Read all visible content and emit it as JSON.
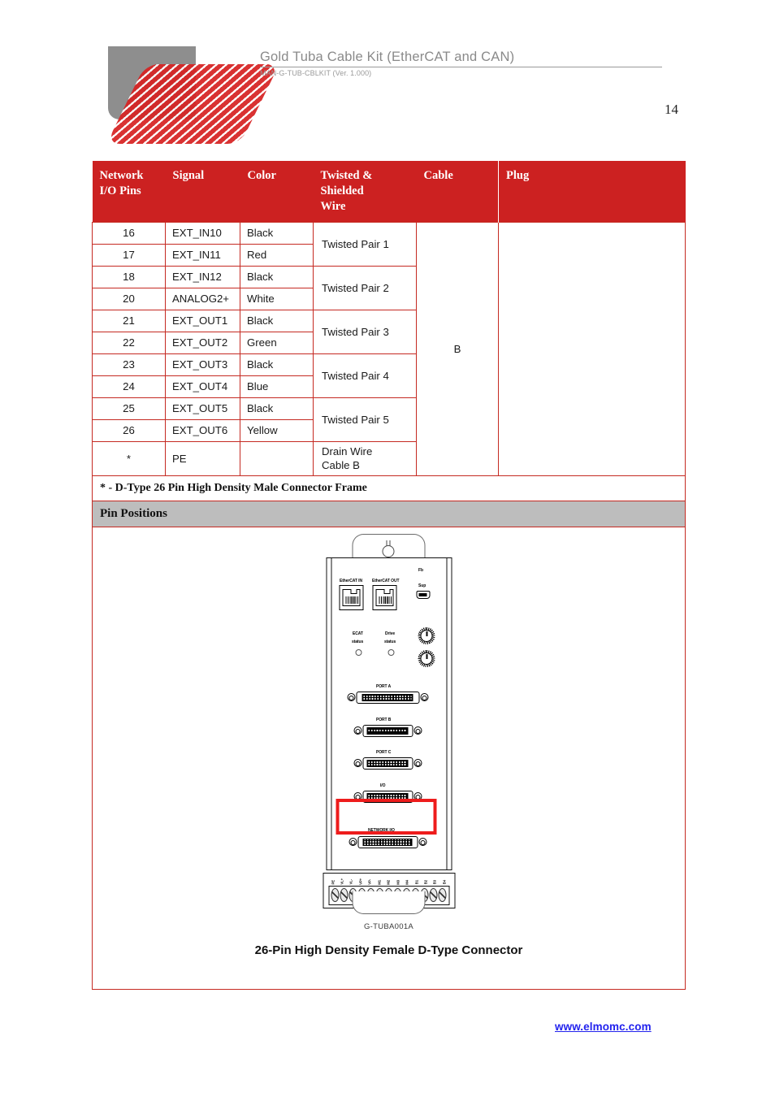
{
  "header": {
    "title": "Gold Tuba Cable Kit (EtherCAT and CAN)",
    "subtitle": "MAN-G-TUB-CBLKIT (Ver. 1.000)",
    "tick": "'",
    "page_number": "14",
    "logo_name": "elmo-logo"
  },
  "colors": {
    "header_red": "#cc2121",
    "border_red": "#c52a22",
    "section_gray": "#bdbdbd",
    "highlight_red": "#ee1c1c",
    "link_blue": "#2222ee",
    "title_gray": "#8a8a8a"
  },
  "table": {
    "columns": [
      "Network I/O Pins",
      "Signal",
      "Color",
      "Twisted & Shielded Wire",
      "Cable",
      "Plug"
    ],
    "column_lines": {
      "c1a": "Network",
      "c1b": "I/O Pins",
      "c4a": "Twisted &",
      "c4b": "Shielded",
      "c4c": "Wire"
    },
    "rows": [
      {
        "pin": "16",
        "signal": "EXT_IN10",
        "color": "Black"
      },
      {
        "pin": "17",
        "signal": "EXT_IN11",
        "color": "Red"
      },
      {
        "pin": "18",
        "signal": "EXT_IN12",
        "color": "Black"
      },
      {
        "pin": "20",
        "signal": "ANALOG2+",
        "color": "White"
      },
      {
        "pin": "21",
        "signal": "EXT_OUT1",
        "color": "Black"
      },
      {
        "pin": "22",
        "signal": "EXT_OUT2",
        "color": "Green"
      },
      {
        "pin": "23",
        "signal": "EXT_OUT3",
        "color": "Black"
      },
      {
        "pin": "24",
        "signal": "EXT_OUT4",
        "color": "Blue"
      },
      {
        "pin": "25",
        "signal": "EXT_OUT5",
        "color": "Black"
      },
      {
        "pin": "26",
        "signal": "EXT_OUT6",
        "color": "Yellow"
      },
      {
        "pin": "*",
        "signal": "PE",
        "color": ""
      }
    ],
    "pairs": [
      "Twisted Pair 1",
      "Twisted Pair 2",
      "Twisted Pair 3",
      "Twisted Pair 4",
      "Twisted Pair 5"
    ],
    "drain": {
      "line1": "Drain Wire",
      "line2": "Cable B"
    },
    "cable": "B",
    "plug": ""
  },
  "note": "* - D-Type 26 Pin High Density Male Connector Frame",
  "section": {
    "title": "Pin Positions"
  },
  "figure": {
    "caption": "26-Pin High Density Female D-Type Connector",
    "drawing_id": "G-TUBA001A",
    "labels": {
      "ethercat_in": "EtherCAT IN",
      "ethercat_out": "EtherCAT OUT",
      "fb": "Fb",
      "sup": "Sup",
      "ecat_status_1": "ECAT",
      "ecat_status_2": "status",
      "drive_status_1": "Drive",
      "drive_status_2": "status",
      "port_a": "PORT A",
      "port_b": "PORT B",
      "port_c": "PORT C",
      "io": "I/O",
      "network_io": "NETWORK I/O"
    },
    "terminal_labels": [
      "PE",
      "VL+",
      "VL-",
      "VP+",
      "VP-",
      "M1",
      "M2",
      "M3",
      "M4",
      "B1",
      "B2",
      "B3",
      "B4"
    ]
  },
  "footer": {
    "url": "www.elmomc.com"
  }
}
